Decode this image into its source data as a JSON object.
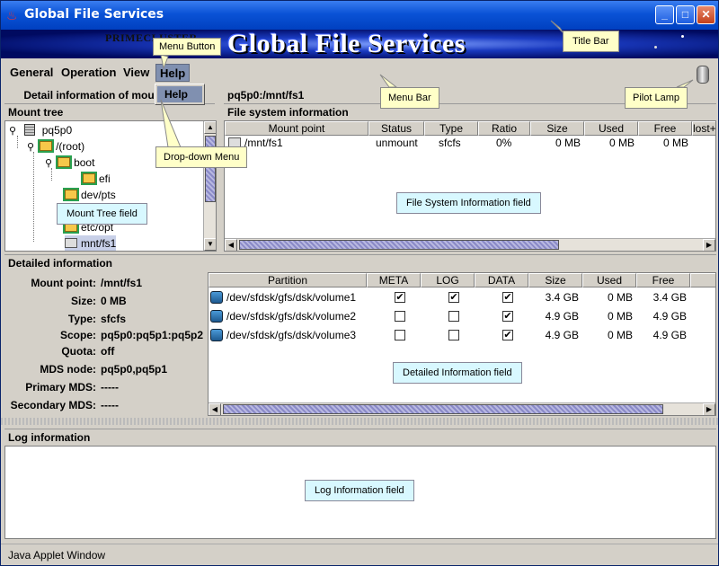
{
  "window": {
    "title": "Global File Services"
  },
  "banner": {
    "brand": "PRIMECLUSTER",
    "title": "Global File Services"
  },
  "menu": {
    "items": [
      "General",
      "Operation",
      "View",
      "Help"
    ],
    "dropdown_items": [
      "Help"
    ]
  },
  "detail_bar": {
    "label": "Detail information of mount point:",
    "mount": "pq5p0:/mnt/fs1"
  },
  "mount_tree": {
    "title": "Mount tree",
    "nodes": [
      "pq5p0",
      "/(root)",
      "boot",
      "efi",
      "dev/pts",
      "etc/opt",
      "mnt/fs1"
    ]
  },
  "fs_info": {
    "title": "File system information",
    "columns": [
      "Mount point",
      "Status",
      "Type",
      "Ratio",
      "Size",
      "Used",
      "Free",
      "lost+"
    ],
    "rows": [
      {
        "mount_point": "/mnt/fs1",
        "status": "unmount",
        "type": "sfcfs",
        "ratio": "0%",
        "size": "0 MB",
        "used": "0 MB",
        "free": "0 MB"
      }
    ]
  },
  "detailed": {
    "title": "Detailed information",
    "labels": [
      "Mount point:",
      "Size:",
      "Type:",
      "Scope:",
      "Quota:",
      "MDS node:",
      "Primary MDS:",
      "Secondary MDS:"
    ],
    "values": [
      "/mnt/fs1",
      "0 MB",
      "sfcfs",
      "pq5p0:pq5p1:pq5p2",
      "off",
      "pq5p0,pq5p1",
      "-----",
      "-----"
    ]
  },
  "partitions": {
    "columns": [
      "Partition",
      "META",
      "LOG",
      "DATA",
      "Size",
      "Used",
      "Free"
    ],
    "rows": [
      {
        "partition": "/dev/sfdsk/gfs/dsk/volume1",
        "meta": true,
        "log": true,
        "data": true,
        "size": "3.4 GB",
        "used": "0 MB",
        "free": "3.4 GB"
      },
      {
        "partition": "/dev/sfdsk/gfs/dsk/volume2",
        "meta": false,
        "log": false,
        "data": true,
        "size": "4.9 GB",
        "used": "0 MB",
        "free": "4.9 GB"
      },
      {
        "partition": "/dev/sfdsk/gfs/dsk/volume3",
        "meta": false,
        "log": false,
        "data": true,
        "size": "4.9 GB",
        "used": "0 MB",
        "free": "4.9 GB"
      }
    ]
  },
  "log": {
    "title": "Log information"
  },
  "status": {
    "text": "Java Applet Window"
  },
  "callouts": {
    "menu_button": "Menu Button",
    "title_bar": "Title Bar",
    "menu_bar": "Menu Bar",
    "pilot_lamp": "Pilot Lamp",
    "dropdown_menu": "Drop-down Menu",
    "mount_tree_field": "Mount Tree field",
    "fs_info_field": "File System Information field",
    "detailed_info_field": "Detailed Information field",
    "log_info_field": "Log Information field"
  }
}
